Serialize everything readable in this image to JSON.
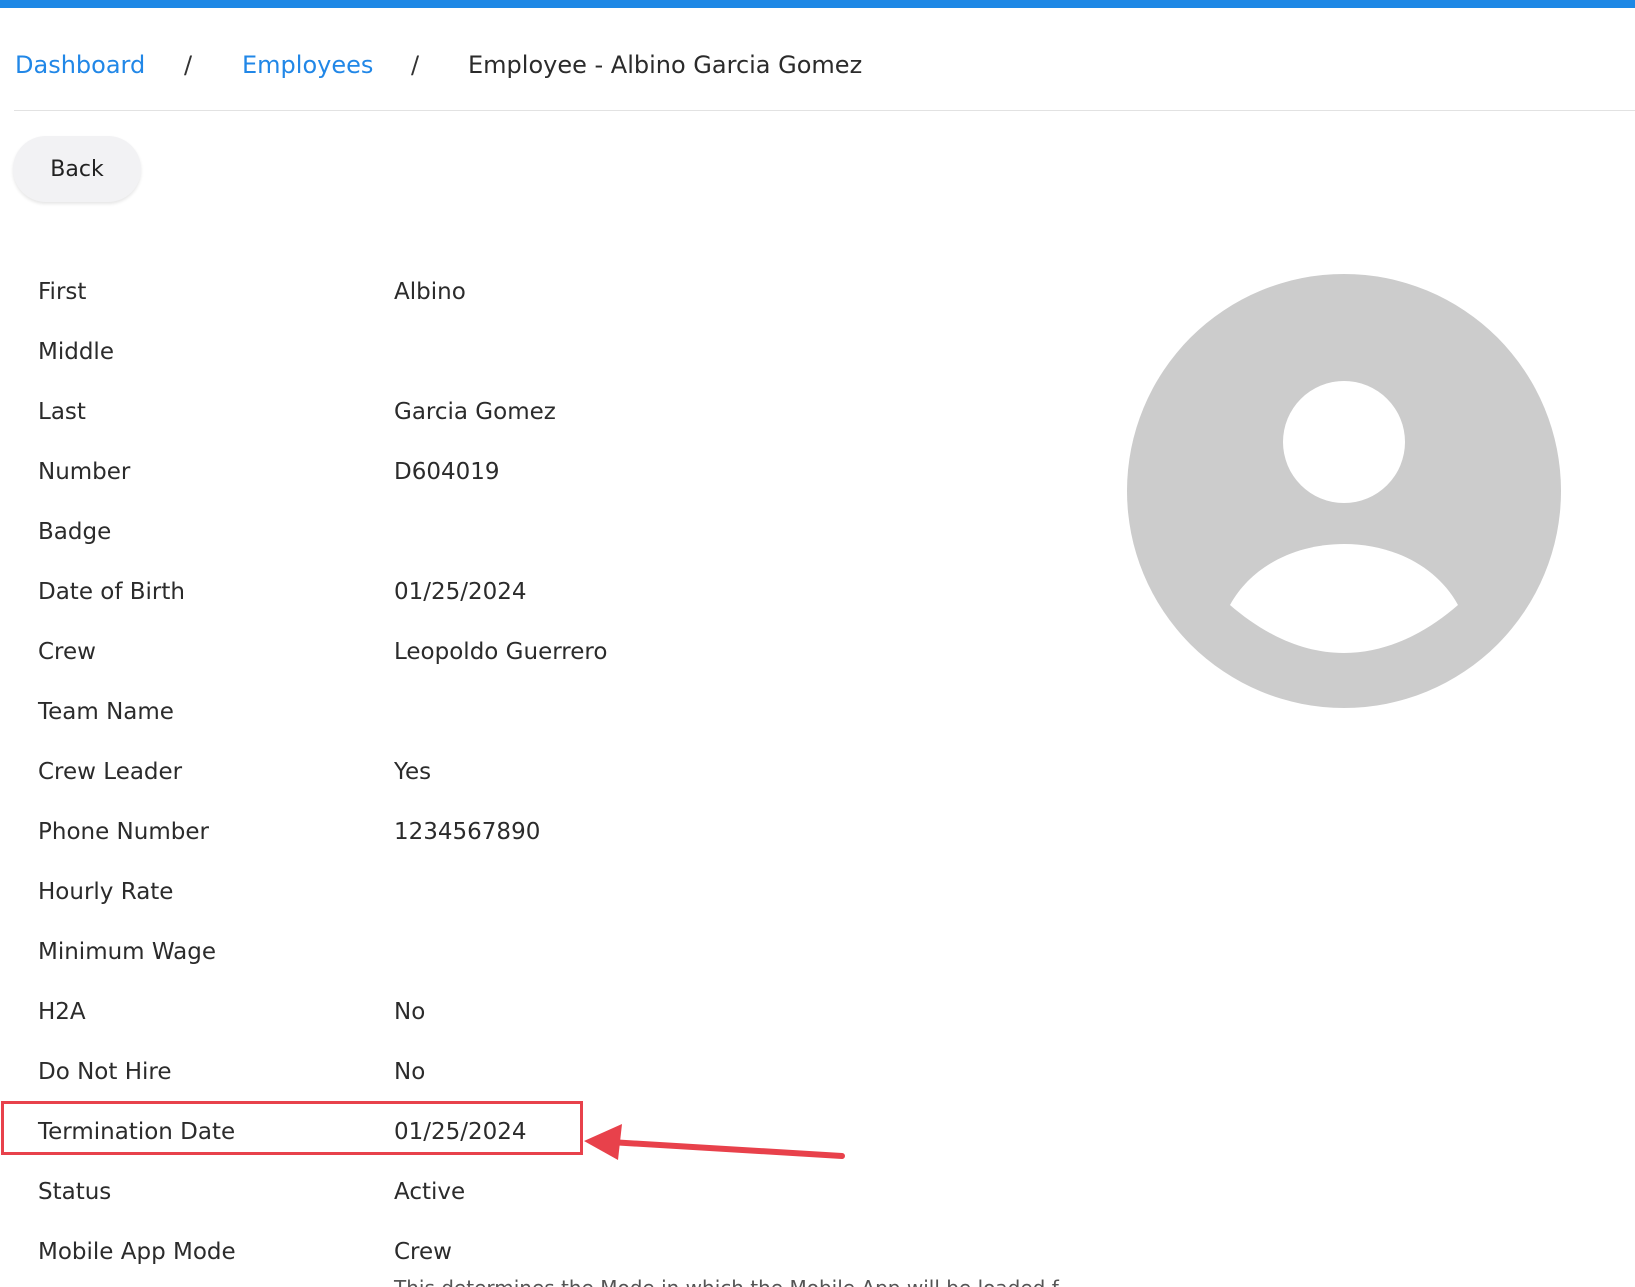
{
  "breadcrumb": {
    "dashboard": "Dashboard",
    "sep1": "/",
    "employees": "Employees",
    "sep2": "/",
    "current": "Employee - Albino Garcia Gomez"
  },
  "back_button": "Back",
  "fields": [
    {
      "label": "First",
      "value": "Albino"
    },
    {
      "label": "Middle",
      "value": ""
    },
    {
      "label": "Last",
      "value": "Garcia Gomez"
    },
    {
      "label": "Number",
      "value": "D604019"
    },
    {
      "label": "Badge",
      "value": ""
    },
    {
      "label": "Date of Birth",
      "value": "01/25/2024"
    },
    {
      "label": "Crew",
      "value": "Leopoldo Guerrero"
    },
    {
      "label": "Team Name",
      "value": ""
    },
    {
      "label": "Crew Leader",
      "value": "Yes"
    },
    {
      "label": "Phone Number",
      "value": "1234567890"
    },
    {
      "label": "Hourly Rate",
      "value": ""
    },
    {
      "label": "Minimum Wage",
      "value": ""
    },
    {
      "label": "H2A",
      "value": "No"
    },
    {
      "label": "Do Not Hire",
      "value": "No"
    },
    {
      "label": "Termination Date",
      "value": "01/25/2024"
    },
    {
      "label": "Status",
      "value": "Active"
    },
    {
      "label": "Mobile App Mode",
      "value": "Crew"
    }
  ],
  "mobile_app_mode_note": "This determines the Mode in which the Mobile App will be loaded f",
  "colors": {
    "accent": "#1e88e5",
    "link": "#2187e7",
    "highlight": "#e8414b",
    "avatar_bg": "#cccccc"
  },
  "icons": {
    "avatar": "user-avatar-icon",
    "annotation": "red-arrow-icon"
  }
}
